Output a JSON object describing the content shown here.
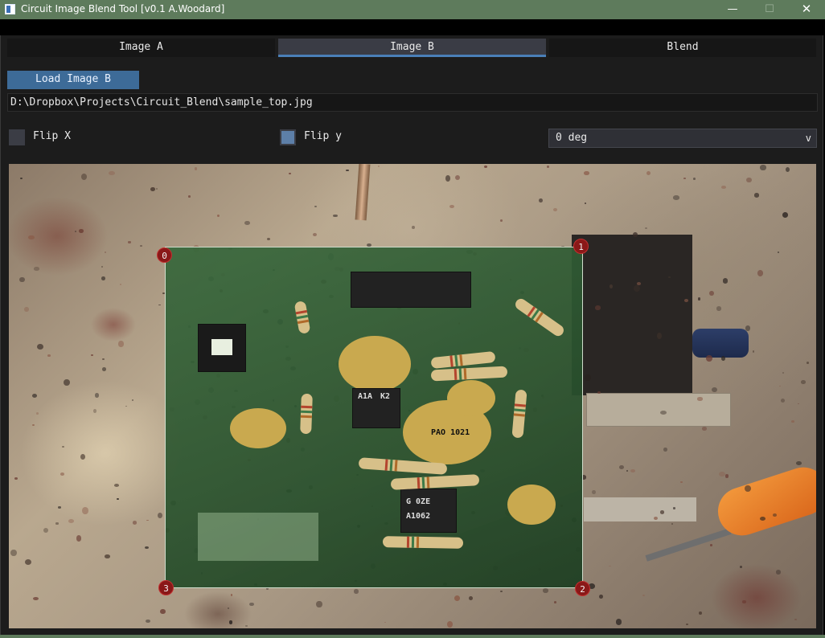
{
  "window": {
    "title": "Circuit Image Blend Tool [v0.1 A.Woodard]",
    "minimize_glyph": "—",
    "maximize_glyph": "☐",
    "close_glyph": "✕"
  },
  "tabs": [
    {
      "label": "Image A",
      "active": false
    },
    {
      "label": "Image B",
      "active": true
    },
    {
      "label": "Blend",
      "active": false
    }
  ],
  "load_button": {
    "label": "Load Image B"
  },
  "file_path": {
    "value": "D:\\Dropbox\\Projects\\Circuit_Blend\\sample_top.jpg"
  },
  "options": {
    "flip_x": {
      "label": "Flip X",
      "checked": false
    },
    "flip_y": {
      "label": "Flip y",
      "checked": true
    },
    "rotation": {
      "selected": "0 deg",
      "chevron": "v"
    }
  },
  "overlay": {
    "chip_labels": [
      "K2",
      "A1A",
      "PAO 1021",
      "A1062",
      "G 0ZE"
    ]
  },
  "corner_markers": [
    {
      "label": "0"
    },
    {
      "label": "1"
    },
    {
      "label": "2"
    },
    {
      "label": "3"
    }
  ],
  "colors": {
    "title_bar": "#5e7b5c",
    "accent": "#4a7fb8",
    "button": "#3d6b98",
    "marker": "#8a1818"
  }
}
